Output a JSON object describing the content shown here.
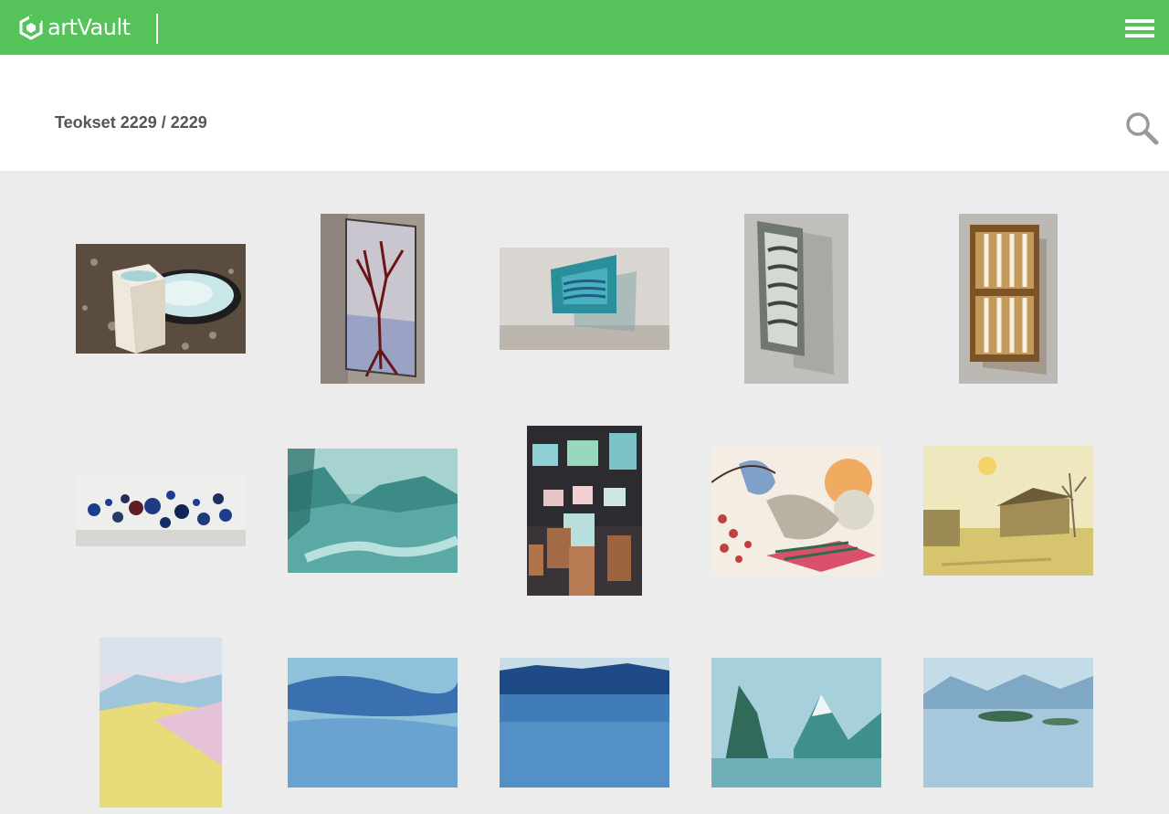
{
  "app": {
    "name": "artVault",
    "logo_icon": "artvault-logo-icon",
    "menu_icon": "hamburger-menu-icon"
  },
  "header": {
    "count_label": "Teokset 2229 / 2229",
    "search_icon": "search-icon"
  },
  "colors": {
    "brand_green": "#55c25a",
    "page_background": "#ececec",
    "header_background": "#ffffff",
    "count_text": "#555555",
    "search_icon": "#999999"
  },
  "artworks": [
    {
      "description": "glass-bowl-on-pedestal-photo"
    },
    {
      "description": "stained-glass-tree-panel-photo"
    },
    {
      "description": "teal-glass-frame-on-wall-photo"
    },
    {
      "description": "grey-glass-panel-photo"
    },
    {
      "description": "amber-glass-panel-photo"
    },
    {
      "description": "glass-plates-on-wall-photo"
    },
    {
      "description": "teal-landscape-painting"
    },
    {
      "description": "paintings-on-tree-stumps-photo"
    },
    {
      "description": "bird-and-colorful-abstract-painting"
    },
    {
      "description": "yellow-farmhouse-painting"
    },
    {
      "description": "pastel-landscape-painting"
    },
    {
      "description": "blue-sky-painting"
    },
    {
      "description": "blue-lake-painting"
    },
    {
      "description": "mountain-landscape-painting"
    },
    {
      "description": "misty-lake-island-painting"
    }
  ]
}
